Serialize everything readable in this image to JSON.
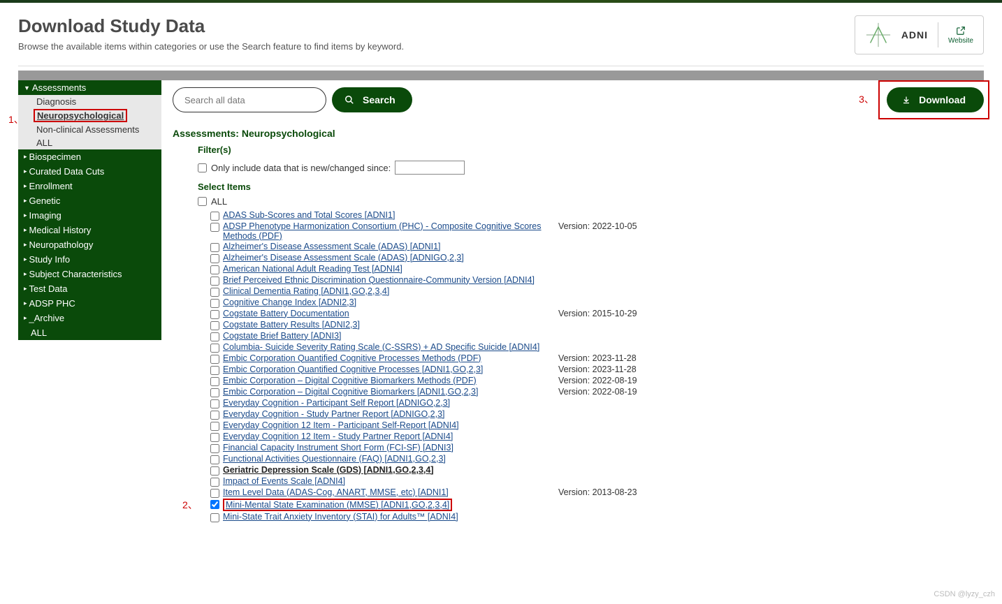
{
  "header": {
    "title": "Download Study Data",
    "subtitle": "Browse the available items within categories or use the Search feature to find items by keyword.",
    "brand": "ADNI",
    "website_label": "Website"
  },
  "sidebar": {
    "categories": [
      {
        "label": "Assessments",
        "expanded": true,
        "children": [
          {
            "label": "Diagnosis"
          },
          {
            "label": "Neuropsychological",
            "selected": true
          },
          {
            "label": "Non-clinical Assessments"
          },
          {
            "label": "ALL"
          }
        ]
      },
      {
        "label": "Biospecimen"
      },
      {
        "label": "Curated Data Cuts"
      },
      {
        "label": "Enrollment"
      },
      {
        "label": "Genetic"
      },
      {
        "label": "Imaging"
      },
      {
        "label": "Medical History"
      },
      {
        "label": "Neuropathology"
      },
      {
        "label": "Study Info"
      },
      {
        "label": "Subject Characteristics"
      },
      {
        "label": "Test Data"
      },
      {
        "label": "ADSP PHC"
      },
      {
        "label": "_Archive"
      }
    ],
    "all_label": "ALL"
  },
  "annotations": {
    "a1": "1、",
    "a2": "2、",
    "a3": "3、"
  },
  "search": {
    "placeholder": "Search all data",
    "button": "Search"
  },
  "download": {
    "label": "Download"
  },
  "main": {
    "breadcrumb": "Assessments: Neuropsychological",
    "filters_heading": "Filter(s)",
    "filter_label": "Only include data that is new/changed since:",
    "select_heading": "Select Items",
    "all_label": "ALL",
    "items": [
      {
        "label": "ADAS Sub-Scores and Total Scores [ADNI1]"
      },
      {
        "label": "ADSP Phenotype Harmonization Consortium (PHC) - Composite Cognitive Scores Methods (PDF)",
        "version": "Version: 2022-10-05"
      },
      {
        "label": "Alzheimer's Disease Assessment Scale (ADAS) [ADNI1]"
      },
      {
        "label": "Alzheimer's Disease Assessment Scale (ADAS) [ADNIGO,2,3]"
      },
      {
        "label": "American National Adult Reading Test [ADNI4]"
      },
      {
        "label": "Brief Perceived Ethnic Discrimination Questionnaire-Community Version [ADNI4]"
      },
      {
        "label": "Clinical Dementia Rating [ADNI1,GO,2,3,4]"
      },
      {
        "label": "Cognitive Change Index [ADNI2,3]"
      },
      {
        "label": "Cogstate Battery Documentation",
        "version": "Version: 2015-10-29"
      },
      {
        "label": "Cogstate Battery Results [ADNI2,3]"
      },
      {
        "label": "Cogstate Brief Battery [ADNI3]"
      },
      {
        "label": "Columbia- Suicide Severity Rating Scale (C-SSRS) + AD Specific Suicide [ADNI4]"
      },
      {
        "label": "Embic Corporation Quantified Cognitive Processes Methods (PDF)",
        "version": "Version: 2023-11-28"
      },
      {
        "label": "Embic Corporation Quantified Cognitive Processes [ADNI1,GO,2,3]",
        "version": "Version: 2023-11-28"
      },
      {
        "label": "Embic Corporation – Digital Cognitive Biomarkers Methods (PDF)",
        "version": "Version: 2022-08-19"
      },
      {
        "label": "Embic Corporation – Digital Cognitive Biomarkers [ADNI1,GO,2,3]",
        "version": "Version: 2022-08-19"
      },
      {
        "label": "Everyday Cognition - Participant Self Report [ADNIGO,2,3]"
      },
      {
        "label": "Everyday Cognition - Study Partner Report [ADNIGO,2,3]"
      },
      {
        "label": "Everyday Cognition 12 Item - Participant Self-Report [ADNI4]"
      },
      {
        "label": "Everyday Cognition 12 Item - Study Partner Report [ADNI4]"
      },
      {
        "label": "Financial Capacity Instrument Short Form (FCI-SF) [ADNI3]"
      },
      {
        "label": "Functional Activities Questionnaire (FAQ) [ADNI1,GO,2,3]"
      },
      {
        "label": "Geriatric Depression Scale (GDS) [ADNI1,GO,2,3,4]",
        "bold": true
      },
      {
        "label": "Impact of Events Scale [ADNI4]"
      },
      {
        "label": "Item Level Data (ADAS-Cog, ANART, MMSE, etc) [ADNI1]",
        "version": "Version: 2013-08-23"
      },
      {
        "label": "Mini-Mental State Examination (MMSE) [ADNI1,GO,2,3,4]",
        "checked": true,
        "highlighted": true
      },
      {
        "label": "Mini-State Trait Anxiety Inventory (STAI) for Adults™ [ADNI4]"
      }
    ]
  },
  "watermark": "CSDN @lyzy_czh"
}
